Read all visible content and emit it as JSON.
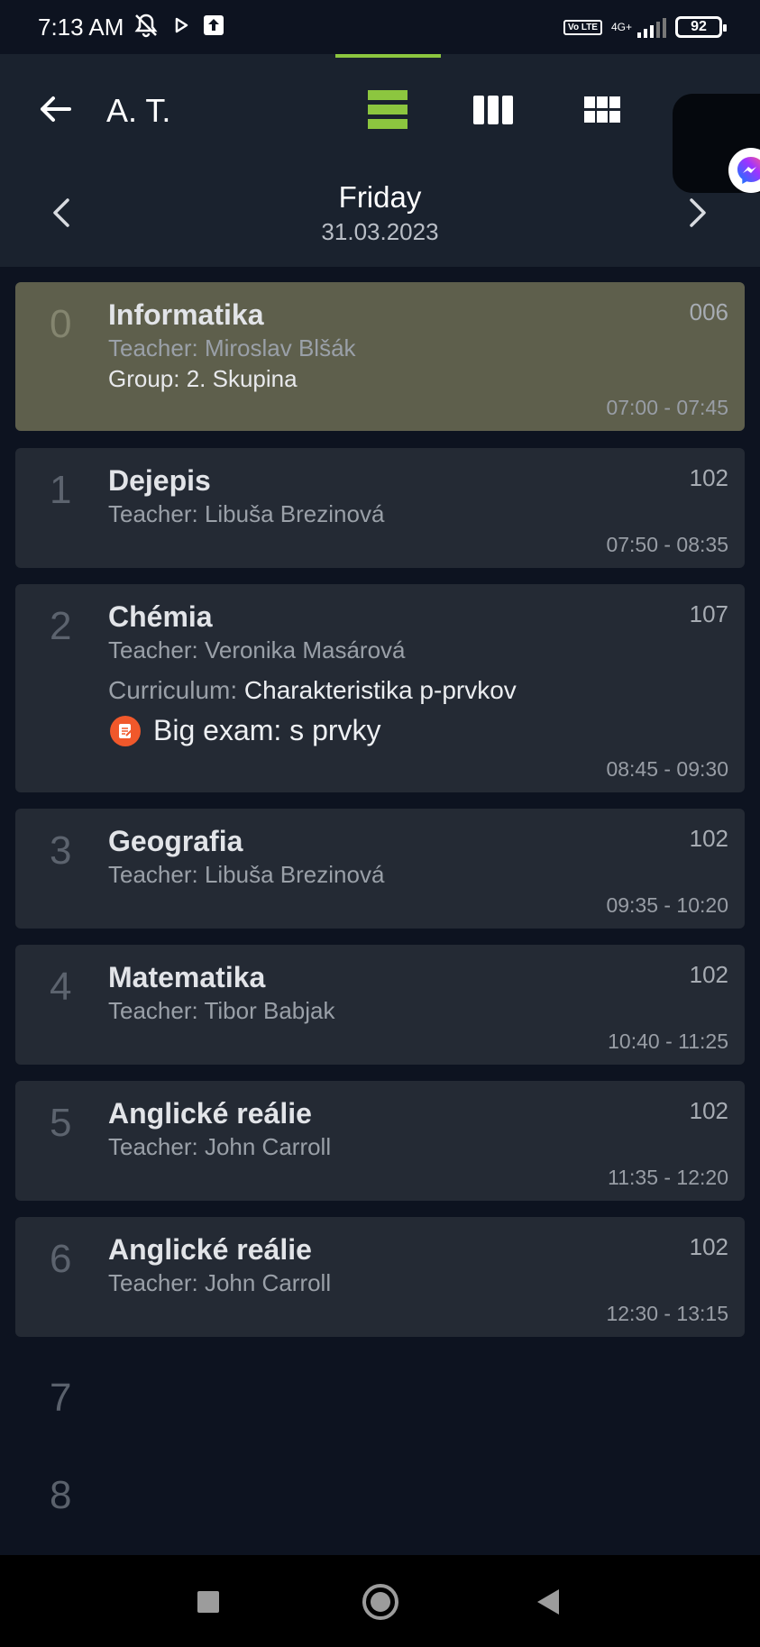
{
  "status_bar": {
    "time": "7:13 AM",
    "icons": [
      "mute-icon",
      "play-icon",
      "upload-icon"
    ],
    "volte": "Vo LTE",
    "network": "4G+",
    "battery": "92"
  },
  "header": {
    "title": "A. T.",
    "accent_color": "#8cc63f",
    "views": [
      "day-view-icon",
      "week-view-icon",
      "grid-view-icon"
    ]
  },
  "day": {
    "name": "Friday",
    "date": "31.03.2023"
  },
  "lessons": [
    {
      "number": "0",
      "subject": "Informatika",
      "room": "006",
      "teacher": "Teacher: Miroslav Blšák",
      "group": "Group: 2. Skupina",
      "time": "07:00 - 07:45"
    },
    {
      "number": "1",
      "subject": "Dejepis",
      "room": "102",
      "teacher": "Teacher: Libuša Brezinová",
      "time": "07:50 - 08:35"
    },
    {
      "number": "2",
      "subject": "Chémia",
      "room": "107",
      "teacher": "Teacher: Veronika Masárová",
      "curriculum_label": "Curriculum:",
      "curriculum": "Charakteristika p-prvkov",
      "exam": "Big exam: s prvky",
      "exam_color": "#f0582b",
      "time": "08:45 - 09:30"
    },
    {
      "number": "3",
      "subject": "Geografia",
      "room": "102",
      "teacher": "Teacher: Libuša Brezinová",
      "time": "09:35 - 10:20"
    },
    {
      "number": "4",
      "subject": "Matematika",
      "room": "102",
      "teacher": "Teacher: Tibor Babjak",
      "time": "10:40 - 11:25"
    },
    {
      "number": "5",
      "subject": "Anglické reálie",
      "room": "102",
      "teacher": "Teacher: John Carroll",
      "time": "11:35 - 12:20"
    },
    {
      "number": "6",
      "subject": "Anglické reálie",
      "room": "102",
      "teacher": "Teacher: John Carroll",
      "time": "12:30 - 13:15"
    }
  ],
  "empty_slots": [
    "7",
    "8"
  ],
  "nav_bar": [
    "recent-apps-icon",
    "home-icon",
    "back-icon"
  ]
}
